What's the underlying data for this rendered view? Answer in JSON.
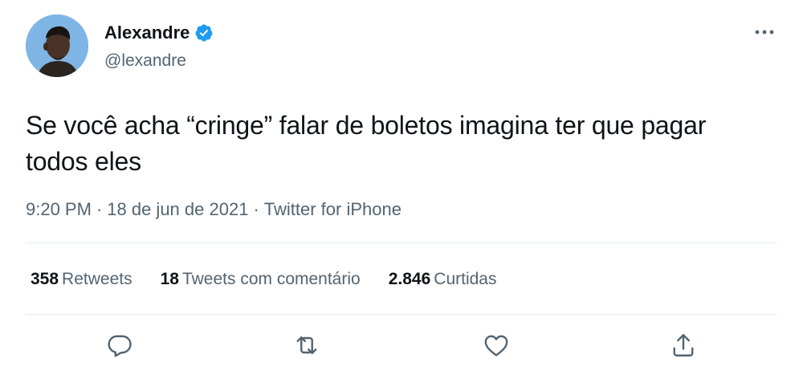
{
  "author": {
    "display_name": "Alexandre",
    "handle": "@lexandre",
    "verified": true,
    "avatar_icon": "profile-photo"
  },
  "tweet": {
    "text": "Se você acha “cringe” falar de boletos imagina ter que pagar todos eles",
    "time": "9:20 PM",
    "date": "18 de jun de 2021",
    "separator": "·",
    "source": "Twitter for iPhone"
  },
  "stats": {
    "retweets_count": "358",
    "retweets_label": "Retweets",
    "quotes_count": "18",
    "quotes_label": "Tweets com comentário",
    "likes_count": "2.846",
    "likes_label": "Curtidas"
  },
  "actions": {
    "reply_icon": "reply-icon",
    "retweet_icon": "retweet-icon",
    "like_icon": "heart-icon",
    "share_icon": "share-icon"
  },
  "colors": {
    "text_primary": "#0f1419",
    "text_secondary": "#536471",
    "verified_blue": "#1d9bf0",
    "divider": "#e6ecf0"
  }
}
